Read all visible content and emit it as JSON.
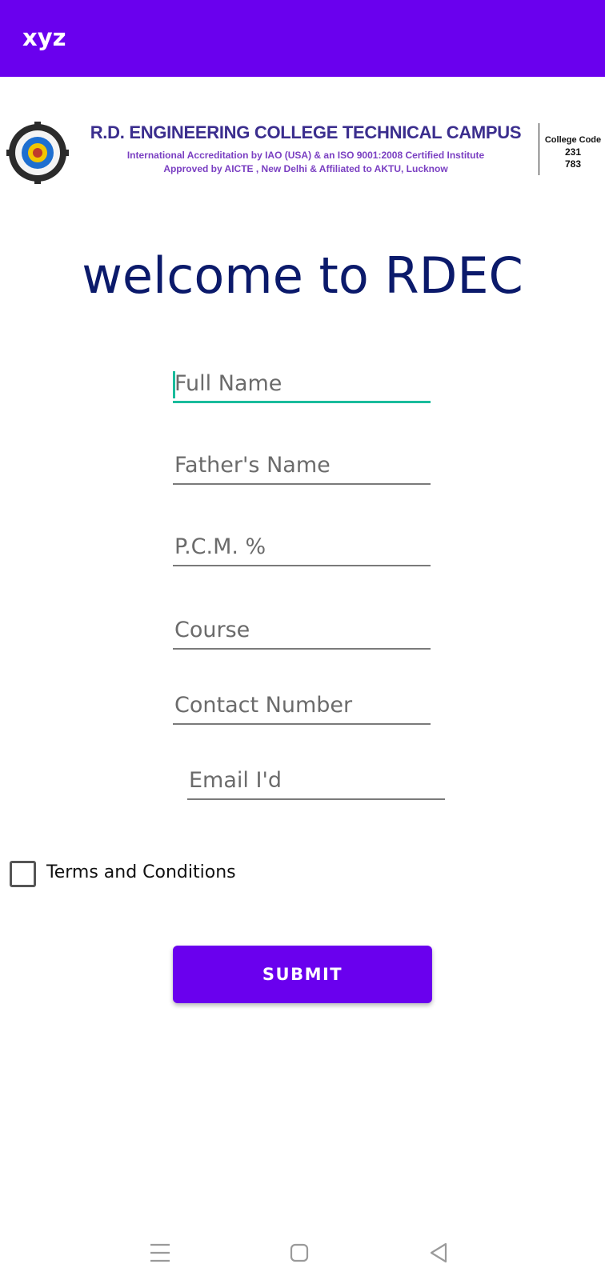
{
  "appbar": {
    "title": "xyz",
    "color": "#6a00ee"
  },
  "banner": {
    "college_name": "R.D. ENGINEERING COLLEGE TECHNICAL CAMPUS",
    "line1": "International Accreditation by IAO (USA) & an ISO 9001:2008 Certified Institute",
    "line2": "Approved by AICTE , New Delhi & Affiliated to AKTU, Lucknow",
    "code_label": "College Code",
    "code_line1": "231",
    "code_line2": "783",
    "logo_icon": "college-emblem"
  },
  "welcome": "welcome to RDEC",
  "form": {
    "full_name": {
      "placeholder": "Full Name",
      "value": ""
    },
    "father_name": {
      "placeholder": "Father's Name",
      "value": ""
    },
    "pcm": {
      "placeholder": "P.C.M. %",
      "value": ""
    },
    "course": {
      "placeholder": "Course",
      "value": ""
    },
    "contact": {
      "placeholder": "Contact Number",
      "value": ""
    },
    "email": {
      "placeholder": "Email I'd",
      "value": ""
    },
    "terms_label": "Terms and Conditions",
    "terms_checked": false,
    "submit_label": "SUBMIT",
    "focus_color": "#1abc9c"
  },
  "nav": {
    "recents_icon": "menu-icon",
    "home_icon": "square-icon",
    "back_icon": "triangle-back-icon"
  }
}
